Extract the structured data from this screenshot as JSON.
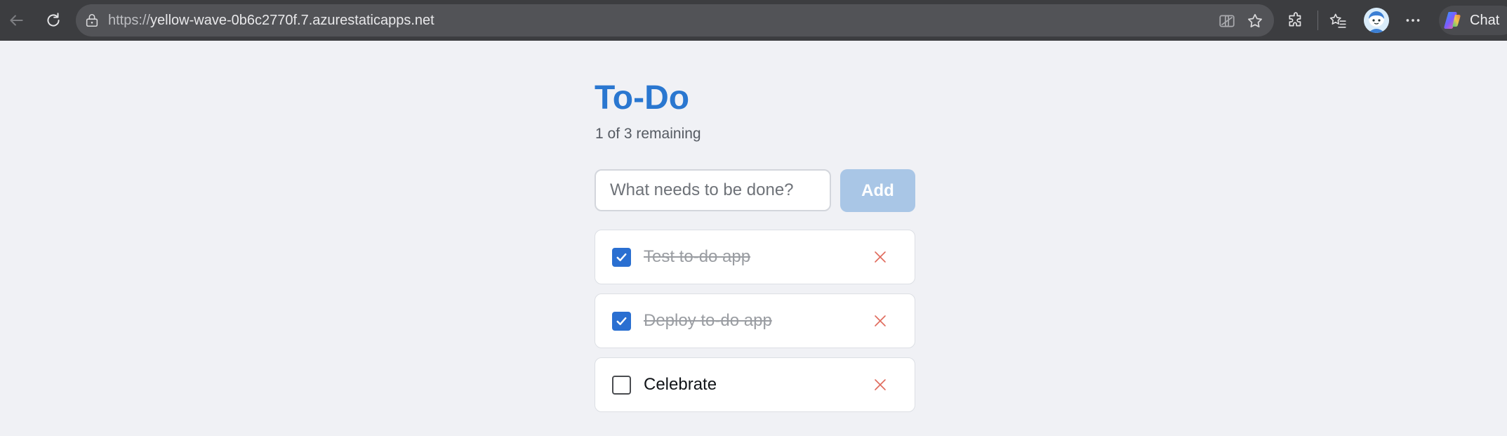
{
  "browser": {
    "url_scheme": "https://",
    "url_host": "yellow-wave-0b6c2770f.7.azurestaticapps.net",
    "chat_label": "Chat",
    "icons": {
      "back": "back-arrow-icon",
      "refresh": "refresh-icon",
      "lock": "lock-icon",
      "tracking": "tracking-prevention-icon",
      "favorite": "star-icon",
      "extensions": "puzzle-icon",
      "favorites": "favorites-list-icon",
      "profile": "avatar",
      "more": "more-dots-icon",
      "copilot": "copilot-logo-icon"
    }
  },
  "app": {
    "title": "To-Do",
    "remaining_text": "1 of 3 remaining",
    "input_placeholder": "What needs to be done?",
    "input_value": "",
    "add_label": "Add",
    "colors": {
      "accent": "#2a77d0",
      "add_button_disabled": "#a9c6e6",
      "delete": "#e06a5c",
      "background": "#f0f1f5"
    },
    "todos": [
      {
        "text": "Test to-do app",
        "done": true
      },
      {
        "text": "Deploy to-do app",
        "done": true
      },
      {
        "text": "Celebrate",
        "done": false
      }
    ]
  }
}
